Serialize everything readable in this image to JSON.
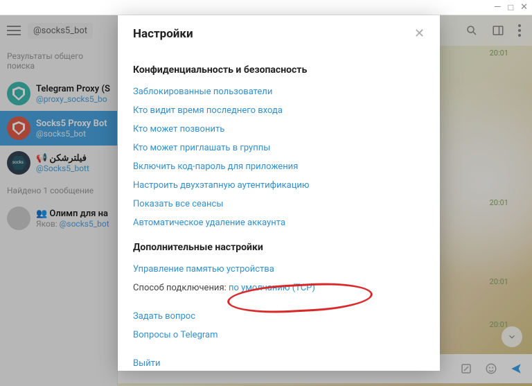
{
  "window": {
    "min": "—",
    "max": "□",
    "close": "✕"
  },
  "search": {
    "chip": "@socks5_bot"
  },
  "sidebar": {
    "results_label": "Результаты общего поиска",
    "found_label": "Найдено 1 сообщение",
    "items": [
      {
        "title": "Telegram Proxy (S",
        "sub": "@proxy_socks5_bo"
      },
      {
        "title": "Socks5 Proxy Bot",
        "sub": "@socks5_bot"
      },
      {
        "title": "📢 فیلترشکن",
        "sub": "@Socks5_bott"
      }
    ],
    "msg": {
      "title": "👥 Олимп для на",
      "author": "Яков:",
      "sub": " @socks5_bot"
    }
  },
  "chat": {
    "timestamps": [
      "20:01",
      "20:01",
      "20:01",
      "20:01"
    ]
  },
  "modal": {
    "title": "Настройки",
    "privacy": {
      "heading": "Конфиденциальность и безопасность",
      "links": [
        "Заблокированные пользователи",
        "Кто видит время последнего входа",
        "Кто может позвонить",
        "Кто может приглашать в группы",
        "Включить код-пароль для приложения",
        "Настроить двухэтапную аутентификацию",
        "Показать все сеансы",
        "Автоматическое удаление аккаунта"
      ]
    },
    "advanced": {
      "heading": "Дополнительные настройки",
      "storage": "Управление памятью устройства",
      "conn_label": "Способ подключения: ",
      "conn_value": "по умолчанию (TCP)"
    },
    "help": {
      "ask": "Задать вопрос",
      "faq": "Вопросы о Telegram"
    },
    "logout": "Выйти"
  }
}
